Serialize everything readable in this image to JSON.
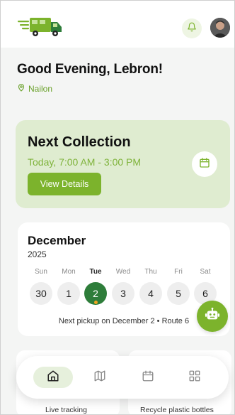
{
  "greeting": "Good Evening, Lebron!",
  "location": "Nailon",
  "next_collection": {
    "title": "Next Collection",
    "time": "Today, 7:00 AM - 3:00 PM",
    "button_label": "View Details"
  },
  "calendar": {
    "month": "December",
    "year": "2025",
    "days": [
      {
        "name": "Sun",
        "num": "30",
        "active": false
      },
      {
        "name": "Mon",
        "num": "1",
        "active": false
      },
      {
        "name": "Tue",
        "num": "2",
        "active": true
      },
      {
        "name": "Wed",
        "num": "3",
        "active": false
      },
      {
        "name": "Thu",
        "num": "4",
        "active": false
      },
      {
        "name": "Fri",
        "num": "5",
        "active": false
      },
      {
        "name": "Sat",
        "num": "6",
        "active": false
      }
    ],
    "pickup_text": "Next pickup on December 2 • Route 6"
  },
  "features": [
    {
      "label": "Live tracking"
    },
    {
      "label": "Recycle plastic bottles"
    }
  ],
  "nav": [
    {
      "icon": "home-icon",
      "active": true
    },
    {
      "icon": "map-icon",
      "active": false
    },
    {
      "icon": "calendar-icon",
      "active": false
    },
    {
      "icon": "grid-icon",
      "active": false
    }
  ],
  "colors": {
    "accent": "#7cb32c",
    "accent_dark": "#2e7d3a",
    "card_green": "#dfecd0",
    "dot": "#f0a522"
  }
}
